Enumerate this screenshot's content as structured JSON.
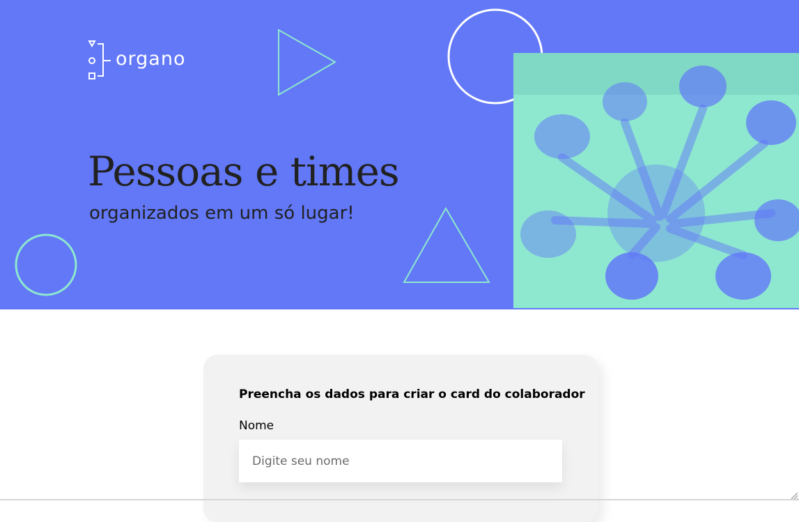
{
  "brand": {
    "name": "organo"
  },
  "hero": {
    "title": "Pessoas e times",
    "subtitle": "organizados em um só lugar!"
  },
  "colors": {
    "banner": "#6278F7",
    "accent": "#8EE8CF",
    "text": "#212121",
    "card": "#F2F2F2"
  },
  "form": {
    "heading": "Preencha os dados para criar o card do colaborador",
    "name_field": {
      "label": "Nome",
      "placeholder": "Digite seu nome",
      "value": ""
    }
  },
  "icons": [
    "logo-mark-icon",
    "triangle-outline-icon",
    "circle-outline-icon",
    "resize-handle-icon"
  ]
}
